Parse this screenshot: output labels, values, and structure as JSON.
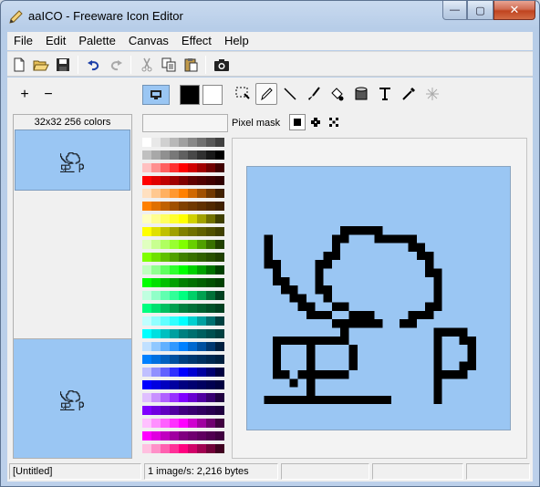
{
  "window": {
    "title": "aaICO - Freeware Icon Editor",
    "app_icon": "pencil-app-icon"
  },
  "caption_buttons": [
    {
      "name": "minimize-button",
      "glyph": "—"
    },
    {
      "name": "maximize-button",
      "glyph": "▢"
    },
    {
      "name": "close-button",
      "glyph": "✕"
    }
  ],
  "menu": [
    "File",
    "Edit",
    "Palette",
    "Canvas",
    "Effect",
    "Help"
  ],
  "toolbar": {
    "buttons": [
      {
        "name": "new-icon",
        "glyph": "🗋"
      },
      {
        "name": "open-icon",
        "glyph": "📂"
      },
      {
        "name": "save-icon",
        "glyph": "💾"
      },
      {
        "name": "undo-icon",
        "glyph": "↶"
      },
      {
        "name": "redo-icon",
        "glyph": "↷"
      },
      {
        "name": "cut-icon",
        "glyph": "✂"
      },
      {
        "name": "copy-icon",
        "glyph": "⧉"
      },
      {
        "name": "paste-icon",
        "glyph": "📋"
      },
      {
        "name": "camera-icon",
        "glyph": "📷"
      }
    ]
  },
  "zoom": {
    "in_glyph": "+",
    "out_glyph": "−"
  },
  "image_list": {
    "label": "32x32 256 colors"
  },
  "colors": {
    "primary": "#000000",
    "secondary": "#ffffff",
    "canvas_bg": "#9ac6f3"
  },
  "tools": [
    {
      "name": "select-tool-icon",
      "glyph": "⬚"
    },
    {
      "name": "pencil-tool-icon",
      "glyph": "✎"
    },
    {
      "name": "line-tool-icon",
      "glyph": "╲"
    },
    {
      "name": "brush-tool-icon",
      "glyph": "🖌"
    },
    {
      "name": "fill-tool-icon",
      "glyph": "⬢"
    },
    {
      "name": "bucket-tool-icon",
      "glyph": "▣"
    },
    {
      "name": "text-tool-icon",
      "glyph": "T"
    },
    {
      "name": "eyedropper-tool-icon",
      "glyph": "⁄"
    },
    {
      "name": "magic-tool-icon",
      "glyph": "✳"
    }
  ],
  "pixel_mask": {
    "label": "Pixel mask",
    "options": [
      {
        "name": "mask-solid-icon",
        "glyph": "■"
      },
      {
        "name": "mask-pattern-icon",
        "glyph": "✥"
      },
      {
        "name": "mask-cross-icon",
        "glyph": "✖"
      }
    ]
  },
  "palette": {
    "columns": 9,
    "rows": [
      [
        "#ffffff",
        "#e8e8e8",
        "#d0d0d0",
        "#b8b8b8",
        "#a0a0a0",
        "#888888",
        "#707070",
        "#585858",
        "#404040"
      ],
      [
        "#c0c0c0",
        "#a8a8a8",
        "#909090",
        "#787878",
        "#606060",
        "#484848",
        "#303030",
        "#181818",
        "#000000"
      ],
      [
        "#ffc0c0",
        "#ff9090",
        "#ff6060",
        "#ff3030",
        "#ff0000",
        "#d00000",
        "#a00000",
        "#700000",
        "#400000"
      ],
      [
        "#ff0000",
        "#e00000",
        "#c00000",
        "#a00000",
        "#800000",
        "#600000",
        "#500000",
        "#400000",
        "#300000"
      ],
      [
        "#ffe0c0",
        "#ffc890",
        "#ffb060",
        "#ff9830",
        "#ff8000",
        "#d06800",
        "#a05000",
        "#703800",
        "#402000"
      ],
      [
        "#ff8000",
        "#e07000",
        "#c06000",
        "#a05000",
        "#804000",
        "#703800",
        "#603000",
        "#502800",
        "#402000"
      ],
      [
        "#ffffc0",
        "#ffff90",
        "#ffff60",
        "#ffff30",
        "#ffff00",
        "#d0d000",
        "#a0a000",
        "#707000",
        "#404000"
      ],
      [
        "#ffff00",
        "#e0e000",
        "#c0c000",
        "#a0a000",
        "#808000",
        "#707000",
        "#606000",
        "#505000",
        "#404000"
      ],
      [
        "#e0ffc0",
        "#c8ff90",
        "#b0ff60",
        "#98ff30",
        "#80ff00",
        "#68d000",
        "#50a000",
        "#387000",
        "#204000"
      ],
      [
        "#80ff00",
        "#70e000",
        "#60c000",
        "#50a000",
        "#408000",
        "#387000",
        "#306000",
        "#285000",
        "#204000"
      ],
      [
        "#c0ffc0",
        "#90ff90",
        "#60ff60",
        "#30ff30",
        "#00ff00",
        "#00d000",
        "#00a000",
        "#007000",
        "#004000"
      ],
      [
        "#00ff00",
        "#00e000",
        "#00c000",
        "#00a000",
        "#008000",
        "#007000",
        "#006000",
        "#005000",
        "#004000"
      ],
      [
        "#c0ffe0",
        "#90ffc8",
        "#60ffb0",
        "#30ff98",
        "#00ff80",
        "#00d068",
        "#00a050",
        "#007038",
        "#004020"
      ],
      [
        "#00ff80",
        "#00e070",
        "#00c060",
        "#00a050",
        "#008040",
        "#007038",
        "#006030",
        "#005028",
        "#004020"
      ],
      [
        "#c0ffff",
        "#90ffff",
        "#60ffff",
        "#30ffff",
        "#00ffff",
        "#00d0d0",
        "#00a0a0",
        "#007070",
        "#004040"
      ],
      [
        "#00ffff",
        "#00e0e0",
        "#00c0c0",
        "#00a0a0",
        "#008080",
        "#007070",
        "#006060",
        "#005050",
        "#004040"
      ],
      [
        "#c0e0ff",
        "#90c8ff",
        "#60b0ff",
        "#3098ff",
        "#0080ff",
        "#0068d0",
        "#0050a0",
        "#003870",
        "#002040"
      ],
      [
        "#0080ff",
        "#0070e0",
        "#0060c0",
        "#0050a0",
        "#004080",
        "#003870",
        "#003060",
        "#002850",
        "#002040"
      ],
      [
        "#c0c0ff",
        "#9090ff",
        "#6060ff",
        "#3030ff",
        "#0000ff",
        "#0000d0",
        "#0000a0",
        "#000070",
        "#000040"
      ],
      [
        "#0000ff",
        "#0000e0",
        "#0000c0",
        "#0000a0",
        "#000080",
        "#000070",
        "#000060",
        "#000050",
        "#000040"
      ],
      [
        "#e0c0ff",
        "#c890ff",
        "#b060ff",
        "#9830ff",
        "#8000ff",
        "#6800d0",
        "#5000a0",
        "#380070",
        "#200040"
      ],
      [
        "#8000ff",
        "#7000e0",
        "#6000c0",
        "#5000a0",
        "#400080",
        "#380070",
        "#300060",
        "#280050",
        "#200040"
      ],
      [
        "#ffc0ff",
        "#ff90ff",
        "#ff60ff",
        "#ff30ff",
        "#ff00ff",
        "#d000d0",
        "#a000a0",
        "#700070",
        "#400040"
      ],
      [
        "#ff00ff",
        "#e000e0",
        "#c000c0",
        "#a000a0",
        "#800080",
        "#700070",
        "#600060",
        "#500050",
        "#400040"
      ],
      [
        "#ffc0e0",
        "#ff90c8",
        "#ff60b0",
        "#ff3098",
        "#ff0080",
        "#d00068",
        "#a00050",
        "#700038",
        "#400020"
      ]
    ]
  },
  "icon_pixels": [
    "...............................",
    "...............................",
    "...............................",
    "...............................",
    "...............................",
    "...............................",
    "...............................",
    "...........#####...............",
    "..#.......##...#####...........",
    "..#.......#........##..........",
    "..#......##.........##.........",
    "..##....##...........#.........",
    "...#....#............##........",
    "...##...#.............#........",
    "....##..##............#........",
    ".....##..#............#........",
    "......##..##.........##........",
    ".......###..###....###.........",
    "..........######..##...........",
    "...........#..........####.....",
    "...#########..........#..##....",
    "...#...#....#.........#...#....",
    "...#...#....#.........#...#....",
    "...#...#....#.........#..##....",
    "...##.######..........####.....",
    ".....#.#..............#........",
    ".......#..............#........",
    "..###############.....#........",
    "...............................",
    "...............................",
    "..............................."
  ],
  "status": {
    "doc": "[Untitled]",
    "info": "1 image/s: 2,216 bytes",
    "cell3": "",
    "cell4": "",
    "cell5": ""
  }
}
